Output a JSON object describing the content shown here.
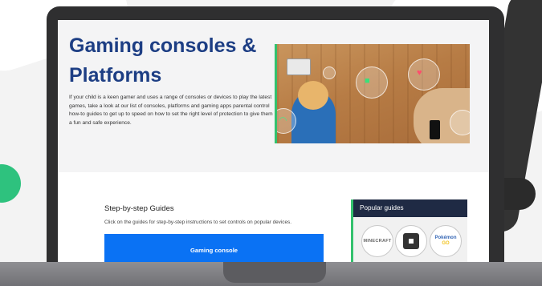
{
  "hero": {
    "title": "Gaming consoles & Platforms",
    "intro": "If your child is a keen gamer and uses a range of consoles or devices to play the latest games, take a look at our list of consoles, platforms and gaming apps parental control how-to guides to get up to speed on how to set the right level of protection to give them a fun and safe experience."
  },
  "guides": {
    "title": "Step-by-step Guides",
    "description": "Click on the guides for step-by-step instructions to set controls on popular devices.",
    "primary_button": "Gaming console"
  },
  "popular": {
    "header": "Popular guides",
    "items": [
      {
        "logo_text": "MINECRAFT"
      },
      {
        "logo_text": ""
      },
      {
        "logo_text_top": "Pokémon",
        "logo_text_bottom": "GO"
      }
    ]
  },
  "colors": {
    "title_blue": "#1d3e84",
    "button_blue": "#0a72f4",
    "accent_green": "#33c16d",
    "dark_navy": "#1f2a44"
  }
}
